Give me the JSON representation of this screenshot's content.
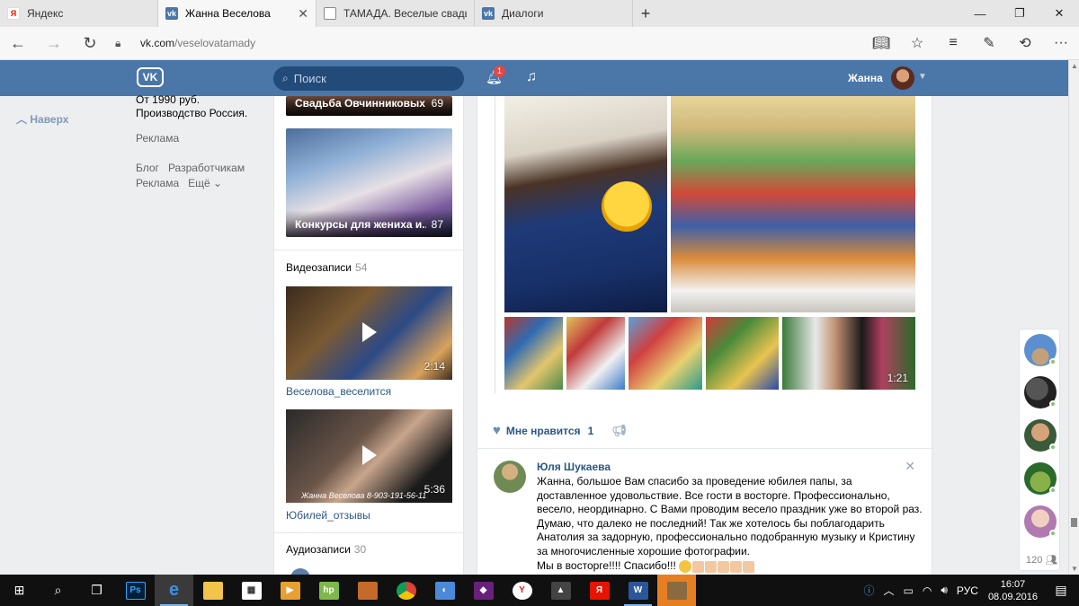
{
  "browser": {
    "tabs": [
      {
        "title": "Яндекс",
        "icon": "yandex-icon",
        "color": "#ffffff",
        "active": false
      },
      {
        "title": "Жанна Веселова",
        "icon": "vk-icon",
        "color": "#4a76a8",
        "active": true
      },
      {
        "title": "ТАМАДА. Веселые свадьб",
        "icon": "page-icon",
        "color": "#ffffff",
        "active": false
      },
      {
        "title": "Диалоги",
        "icon": "vk-icon",
        "color": "#4a76a8",
        "active": false
      }
    ],
    "url_domain": "vk.com",
    "url_path": "/veselovatamady"
  },
  "vk_header": {
    "logo": "VK",
    "search_placeholder": "Поиск",
    "notifications_count": "1",
    "user_name": "Жанна"
  },
  "left_menu": {
    "back_to_top": "Наверх",
    "ad_price": "От 1990 руб.",
    "ad_origin": "Производство Россия.",
    "ad_label": "Реклама",
    "footer_links": [
      "Блог",
      "Разработчикам",
      "Реклама",
      "Ещё ⌄"
    ]
  },
  "albums": [
    {
      "name": "Свадьба Овчинниковых",
      "count": "69"
    },
    {
      "name": "Конкурсы для жениха и...",
      "count": "87"
    }
  ],
  "videos_section": {
    "title": "Видеозаписи",
    "count": "54"
  },
  "videos": [
    {
      "title": "Веселова_веселится",
      "duration": "2:14",
      "overlay": ""
    },
    {
      "title": "Юбилей_отзывы",
      "duration": "5:36",
      "overlay": "Жанна Веселова  8-903-191-56-11"
    }
  ],
  "audio_section": {
    "title": "Аудиозаписи",
    "count": "30"
  },
  "post": {
    "like_label": "Мне нравится",
    "like_count": "1",
    "video_duration": "1:21"
  },
  "comment": {
    "author": "Юля Шукаева",
    "text": "Жанна, большое Вам спасибо за проведение юбилея папы, за доставленное удовольствие. Все гости в восторге. Профессионально, весело, неординарно. С Вами проводим весело праздник уже во второй раз. Думаю, что далеко не последний! Так же хотелось бы поблагодарить Анатолия за задорную, профессионально подобранную музыку и Кристину за многочисленные хорошие фотографии.",
    "last_line": "Мы в восторге!!!! Спасибо!!!"
  },
  "dialogs": {
    "count": "120"
  },
  "taskbar": {
    "language": "РУС",
    "time": "16:07",
    "date": "08.09.2016"
  },
  "colors": {
    "vk_blue": "#4a76a8",
    "link": "#2a5885",
    "background": "#edeef0"
  }
}
